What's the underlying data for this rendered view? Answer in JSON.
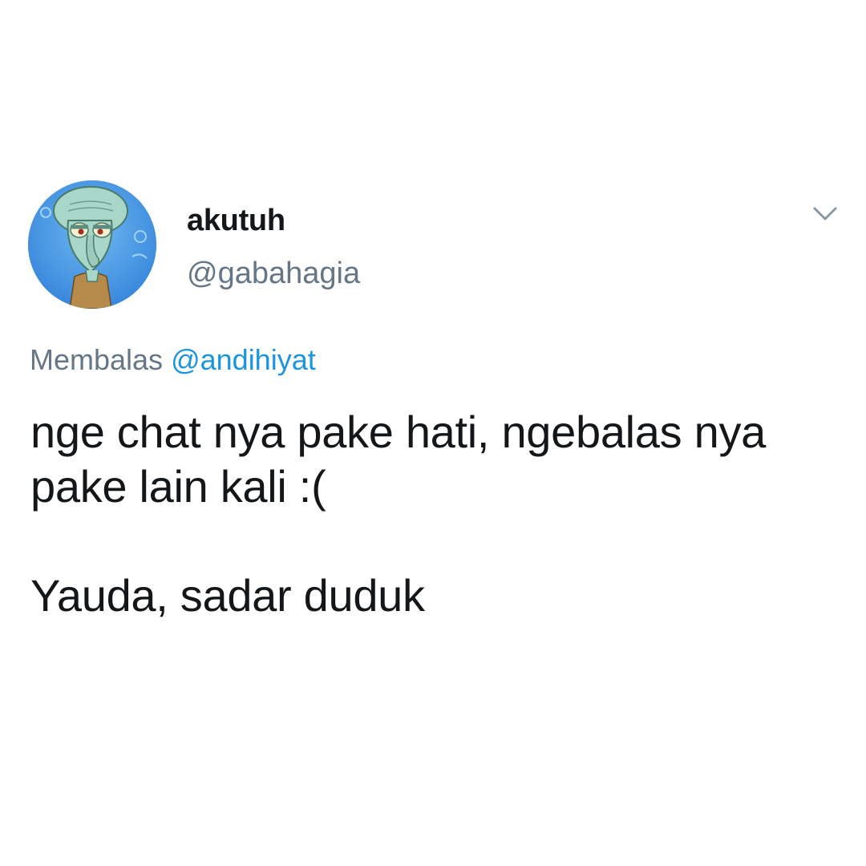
{
  "tweet": {
    "avatar_icon": "squidward-avatar-icon",
    "display_name": "akutuh",
    "handle": "@gabahagia",
    "menu_icon": "chevron-down-icon",
    "reply_prefix": "Membalas",
    "reply_mention": "@andihiyat",
    "text_paragraph_1": "nge chat nya pake hati, ngebalas nya pake lain kali :(",
    "text_paragraph_2": "Yauda, sadar duduk"
  },
  "colors": {
    "display_name": "#14171a",
    "secondary_text": "#657786",
    "mention": "#1b95e0",
    "background": "#ffffff"
  }
}
